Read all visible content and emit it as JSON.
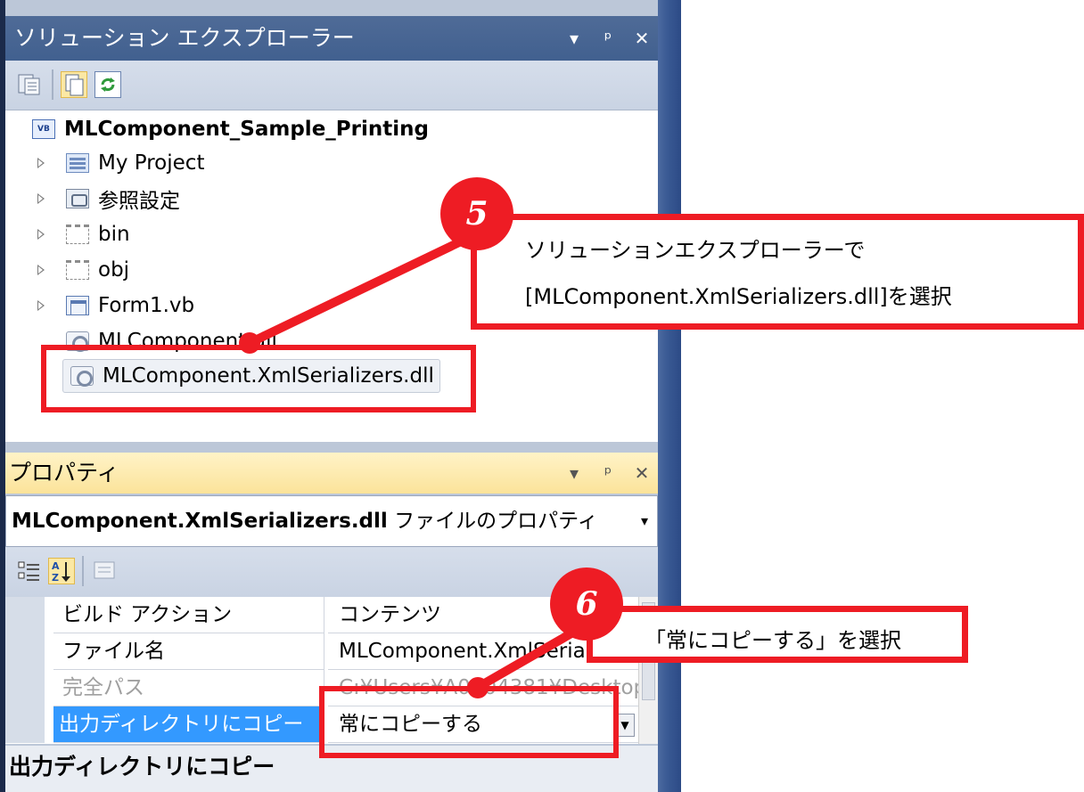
{
  "solution_explorer": {
    "title": "ソリューション エクスプローラー",
    "header_buttons": [
      "▾",
      "ᵖ",
      "✕"
    ],
    "toolbar_icons": [
      "properties-icon",
      "show-all-files-icon",
      "refresh-icon"
    ],
    "tree": {
      "root": "MLComponent_Sample_Printing",
      "items": [
        {
          "label": "My Project",
          "icon": "my-project-icon",
          "expandable": true
        },
        {
          "label": "参照設定",
          "icon": "references-icon",
          "expandable": true
        },
        {
          "label": "bin",
          "icon": "folder-icon",
          "expandable": true
        },
        {
          "label": "obj",
          "icon": "folder-icon",
          "expandable": true
        },
        {
          "label": "Form1.vb",
          "icon": "form-icon",
          "expandable": true
        },
        {
          "label": "MLComponent.dll",
          "icon": "dll-icon",
          "expandable": false
        },
        {
          "label": "MLComponent.XmlSerializers.dll",
          "icon": "dll-icon",
          "expandable": false,
          "selected": true
        }
      ]
    }
  },
  "properties": {
    "title": "プロパティ",
    "header_buttons": [
      "▾",
      "ᵖ",
      "✕"
    ],
    "object_name": "MLComponent.XmlSerializers.dll",
    "object_suffix": "ファイルのプロパティ",
    "object_dropdown": "▾",
    "toolbar_icons": [
      "categorized-icon",
      "alphabetical-icon",
      "property-pages-icon"
    ],
    "rows": [
      {
        "name": "ビルド アクション",
        "value": "コンテンツ"
      },
      {
        "name": "ファイル名",
        "value": "MLComponent.XmlSerializers.dll"
      },
      {
        "name": "完全パス",
        "value": "C:¥Users¥A0004381¥Desktop"
      },
      {
        "name": "出力ディレクトリにコピー",
        "value": "常にコピーする"
      }
    ],
    "description_title": "出力ディレクトリにコピー"
  },
  "annotations": {
    "step5": {
      "number": "5",
      "line1": "ソリューションエクスプローラーで",
      "line2": "[MLComponent.XmlSerializers.dll]を選択"
    },
    "step6": {
      "number": "6",
      "text": "「常にコピーする」を選択"
    },
    "accent_color": "#ee1c24"
  }
}
